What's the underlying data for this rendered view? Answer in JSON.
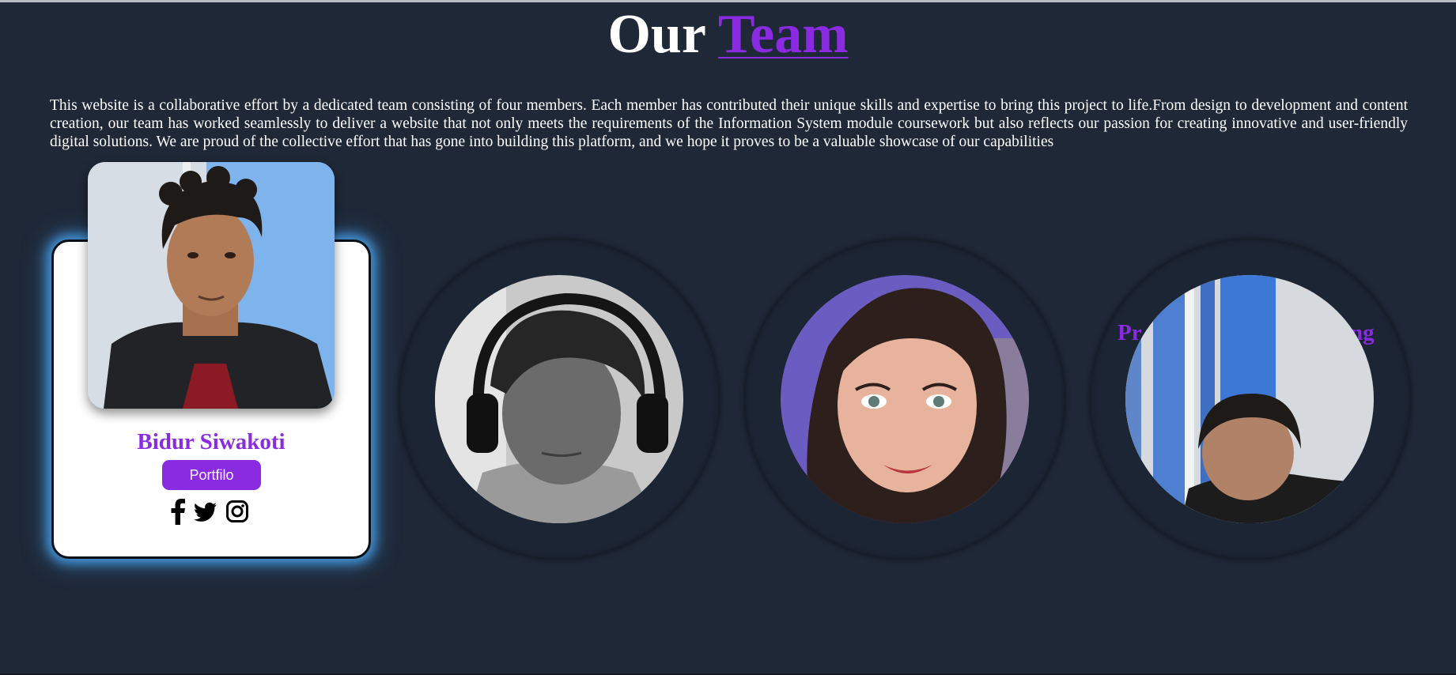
{
  "header": {
    "title_main": "Our",
    "title_accent": "Team"
  },
  "intro": {
    "text": "This website is a collaborative effort by a dedicated team consisting of four members. Each member has contributed their unique skills and expertise to bring this project to life.From design to development and content creation, our team has worked seamlessly to deliver a website that not only meets the requirements of the Information System module coursework but also reflects our passion for creating innovative and user-friendly digital solutions. We are proud of the collective effort that has gone into building this platform, and we hope it proves to be a valuable showcase of our capabilities"
  },
  "members": [
    {
      "name": "Bidur Siwakoti",
      "button_label": "Portfilo",
      "socials": [
        "facebook-icon",
        "twitter-icon",
        "instagram-icon"
      ]
    },
    {
      "photo": "member-2-photo"
    },
    {
      "photo": "member-3-photo"
    },
    {
      "photo": "member-4-photo",
      "peek_left": "Pr",
      "peek_right": "ng"
    }
  ],
  "colors": {
    "background": "#1f2837",
    "accent": "#8a2be2",
    "glow": "#4dafff"
  }
}
